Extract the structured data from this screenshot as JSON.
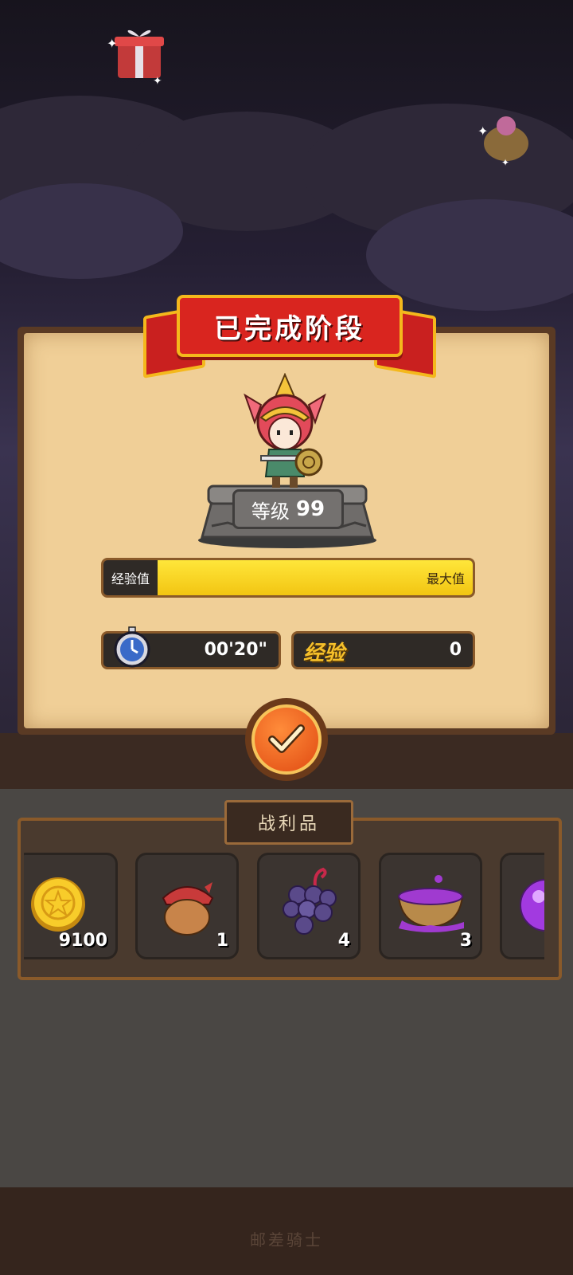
{
  "result": {
    "title": "已完成阶段",
    "level_label": "等级",
    "level_value": "99",
    "xp_label": "经验值",
    "xp_max_label": "最大值",
    "xp_fill_fraction": 1.0,
    "time_value": "00'20\"",
    "exp_label": "经验",
    "exp_value": "0"
  },
  "loot": {
    "title": "战利品",
    "items": [
      {
        "icon": "gold-coin-icon",
        "count": "9100"
      },
      {
        "icon": "acorn-icon",
        "count": "1"
      },
      {
        "icon": "grapes-icon",
        "count": "4"
      },
      {
        "icon": "purple-potion-bowl-icon",
        "count": "3"
      },
      {
        "icon": "purple-orb-icon",
        "count": ""
      }
    ]
  },
  "footer": {
    "text": "邮差骑士"
  },
  "colors": {
    "ribbon": "#d9251f",
    "xp_fill": "#f2c512",
    "panel": "#f0cf97"
  }
}
